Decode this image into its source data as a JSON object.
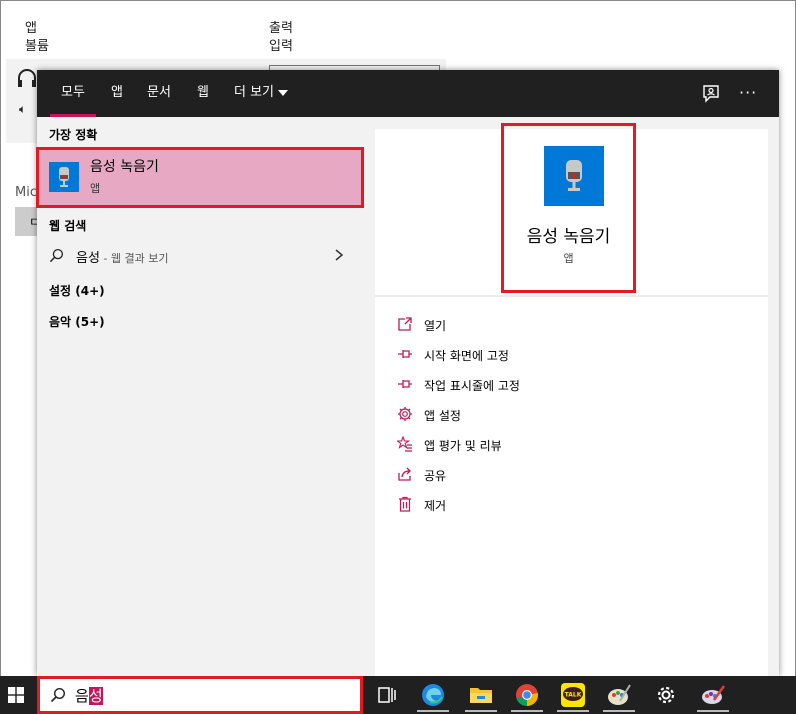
{
  "background": {
    "col1_line1": "앱",
    "col1_line2": "볼륨",
    "col2_line1": "출력",
    "col2_line2": "입력",
    "partial_label": "Mic",
    "partial_button": "ㄷ"
  },
  "start_menu": {
    "tabs": [
      {
        "label": "모두",
        "active": true
      },
      {
        "label": "앱"
      },
      {
        "label": "문서"
      },
      {
        "label": "웹"
      },
      {
        "label": "더 보기"
      }
    ],
    "more_label": "···",
    "best_match": {
      "heading": "가장 정확",
      "title": "음성 녹음기",
      "subtitle": "앱"
    },
    "web_search": {
      "heading": "웹 검색",
      "query": "음성",
      "suffix": " - 웹 결과 보기"
    },
    "categories": [
      {
        "label": "설정 (4+)"
      },
      {
        "label": "음악 (5+)"
      }
    ],
    "detail": {
      "title": "음성 녹음기",
      "subtitle": "앱",
      "actions": [
        {
          "label": "열기",
          "icon": "open-icon"
        },
        {
          "label": "시작 화면에 고정",
          "icon": "pin-icon"
        },
        {
          "label": "작업 표시줄에 고정",
          "icon": "pin-icon"
        },
        {
          "label": "앱 설정",
          "icon": "gear-icon"
        },
        {
          "label": "앱 평가 및 리뷰",
          "icon": "star-list-icon"
        },
        {
          "label": "공유",
          "icon": "share-icon"
        },
        {
          "label": "제거",
          "icon": "trash-icon"
        }
      ]
    }
  },
  "taskbar": {
    "search_text_plain": "음",
    "search_text_selected": "성",
    "icons": [
      "task-view-icon",
      "edge-icon",
      "file-explorer-icon",
      "chrome-icon",
      "kakaotalk-icon",
      "paint-icon",
      "settings-icon",
      "paint-3d-icon"
    ],
    "kakao_label": "TALK"
  },
  "colors": {
    "accent": "#c2185b",
    "highlight": "#e01b24",
    "tile_blue": "#0078d7",
    "dark": "#202020"
  }
}
